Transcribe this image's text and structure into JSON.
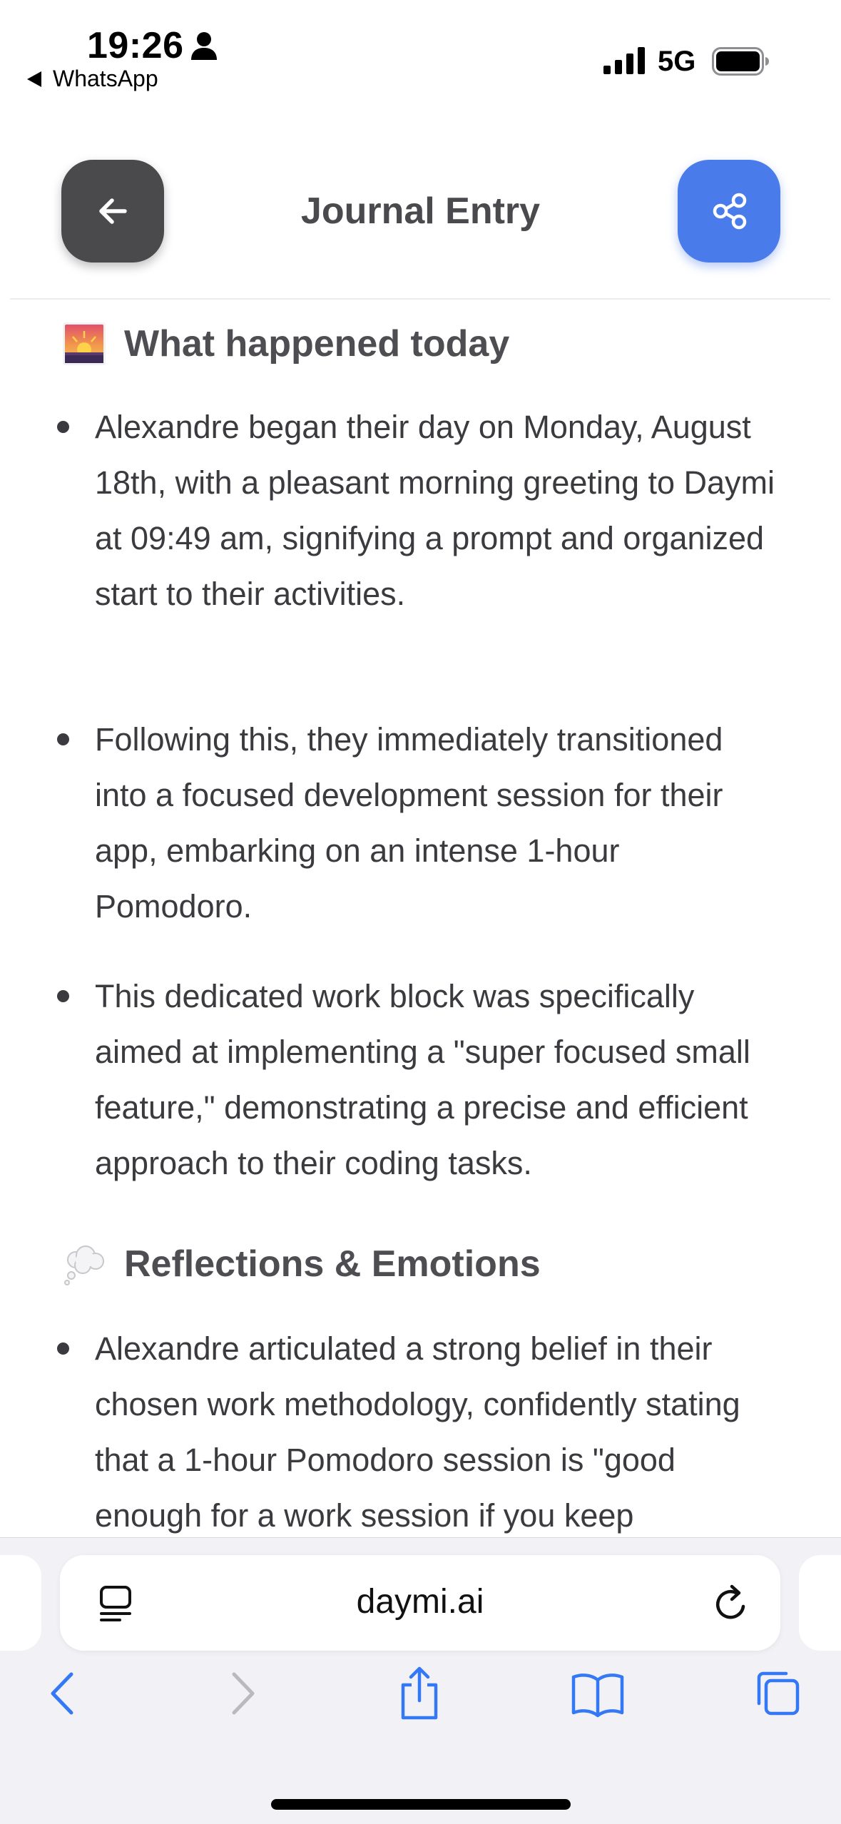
{
  "status_bar": {
    "time": "19:26",
    "back_app": "WhatsApp",
    "network": "5G"
  },
  "header": {
    "title": "Journal Entry"
  },
  "sections": [
    {
      "emoji": "sunrise",
      "heading": "What happened today",
      "bullets": [
        "Alexandre began their day on Monday, August 18th, with a pleasant morning greeting to Daymi at 09:49 am, signifying a prompt and organized start to their activities.",
        "Following this, they immediately transitioned into a focused development session for their app, embarking on an intense 1-hour Pomodoro.",
        "This dedicated work block was specifically aimed at implementing a \"super focused small feature,\" demonstrating a precise and efficient approach to their coding tasks."
      ]
    },
    {
      "emoji": "thought-balloon",
      "heading": "Reflections & Emotions",
      "bullets": [
        "Alexandre articulated a strong belief in their chosen work methodology, confidently stating that a 1-hour Pomodoro session is \"good enough for a work session if you keep"
      ]
    }
  ],
  "browser": {
    "url": "daymi.ai"
  },
  "colors": {
    "accent_blue": "#4a7bea",
    "back_button": "#4a4a4c",
    "ios_blue": "#3478f6"
  }
}
